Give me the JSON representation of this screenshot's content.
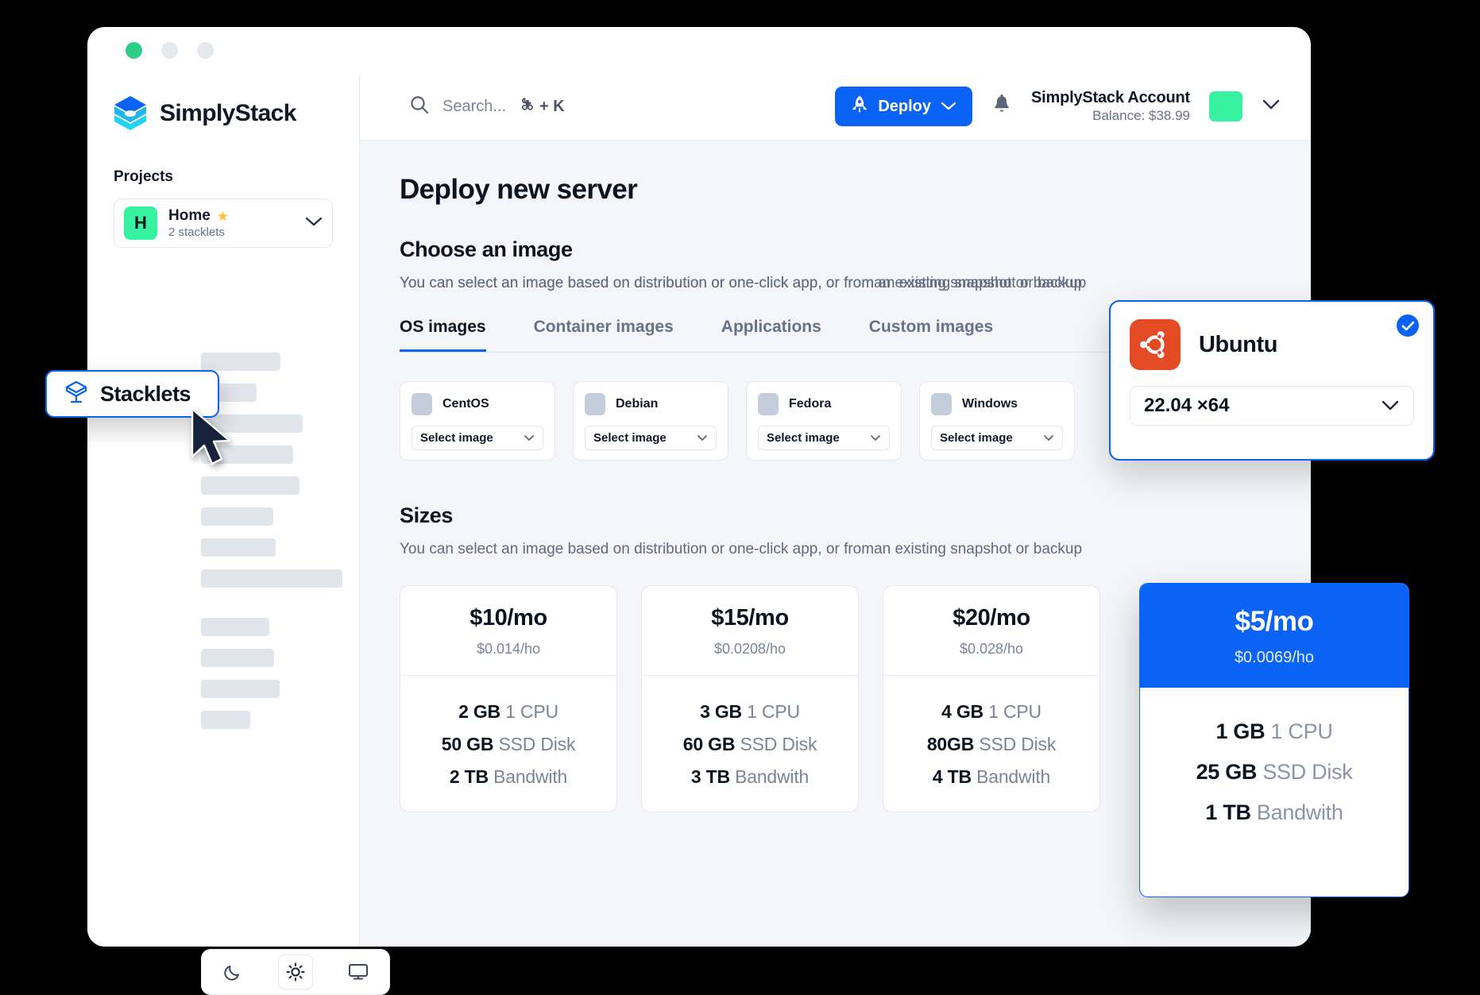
{
  "window": {
    "dots": [
      "green",
      "grey",
      "grey"
    ]
  },
  "sidebar": {
    "brand_name": "SimplyStack",
    "brand_logo_icon": "simplystack-cube-logo",
    "section_label": "Projects",
    "project": {
      "avatar_letter": "H",
      "name": "Home",
      "favorite_icon": "star-icon",
      "subtitle": "2 stacklets",
      "expand_icon": "chevron-down-icon"
    },
    "skeleton_widths": [
      100,
      70,
      128,
      116,
      124,
      91,
      94,
      178,
      86,
      92,
      99,
      62
    ],
    "theme": {
      "dark_label": "moon-icon",
      "light_label": "sun-icon",
      "system_label": "monitor-icon",
      "active": "light"
    }
  },
  "topbar": {
    "search_placeholder": "Search...",
    "search_icon": "search-icon",
    "shortcut": "+ K",
    "shortcut_key_icon": "command-icon",
    "deploy_label": "Deploy",
    "deploy_icon": "rocket-icon",
    "deploy_chevron_icon": "chevron-down-icon",
    "notifications_icon": "bell-icon",
    "account_name": "SimplyStack Account",
    "account_balance": "Balance: $38.99",
    "account_avatar": "avatar",
    "account_chevron_icon": "chevron-down-icon",
    "accent_color": "#0a63f5",
    "avatar_color": "#37f2a0"
  },
  "main": {
    "page_title": "Deploy new server",
    "image_section": {
      "title": "Choose an image",
      "description": "You can select an image based on distribution or one-click app, or from an existing snapshot or backup",
      "description_overlap": "You can select an image based on distribution or one-click app, or froman existing snapshot or backup",
      "tabs": [
        {
          "label": "OS images",
          "active": true
        },
        {
          "label": "Container images",
          "active": false
        },
        {
          "label": "Applications",
          "active": false
        },
        {
          "label": "Custom images",
          "active": false
        }
      ],
      "os_cards": [
        {
          "name": "CentOS",
          "select_label": "Select image"
        },
        {
          "name": "Debian",
          "select_label": "Select image"
        },
        {
          "name": "Fedora",
          "select_label": "Select image"
        },
        {
          "name": "Windows",
          "select_label": "Select image"
        }
      ]
    },
    "sizes_section": {
      "title": "Sizes",
      "description": "You can select an image based on distribution or one-click app, or froman existing snapshot or backup",
      "cards": [
        {
          "price": "$10/mo",
          "hourly": "$0.014/ho",
          "ram": "2 GB",
          "cpu": "1 CPU",
          "disk": "50 GB",
          "disk_label": "SSD Disk",
          "bandwidth": "2 TB",
          "bandwidth_label": "Bandwith"
        },
        {
          "price": "$15/mo",
          "hourly": "$0.0208/ho",
          "ram": "3 GB",
          "cpu": "1 CPU",
          "disk": "60 GB",
          "disk_label": "SSD Disk",
          "bandwidth": "3 TB",
          "bandwidth_label": "Bandwith"
        },
        {
          "price": "$20/mo",
          "hourly": "$0.028/ho",
          "ram": "4 GB",
          "cpu": "1 CPU",
          "disk": "80GB",
          "disk_label": "SSD Disk",
          "bandwidth": "4 TB",
          "bandwidth_label": "Bandwith"
        }
      ]
    }
  },
  "ubuntu_card": {
    "name": "Ubuntu",
    "logo_icon": "ubuntu-logo-icon",
    "logo_color": "#e34b24",
    "version": "22.04 ×64",
    "selected": true,
    "check_icon": "check-icon",
    "chevron_icon": "chevron-down-icon"
  },
  "five_card": {
    "price": "$5/mo",
    "hourly": "$0.0069/ho",
    "ram": "1 GB",
    "cpu": "1 CPU",
    "disk": "25 GB",
    "disk_label": "SSD Disk",
    "bandwidth": "1 TB",
    "bandwidth_label": "Bandwith",
    "header_color": "#0a63f5"
  },
  "stacklets_chip": {
    "label": "Stacklets",
    "icon": "stacklet-cube-icon",
    "cursor_icon": "mouse-cursor"
  }
}
